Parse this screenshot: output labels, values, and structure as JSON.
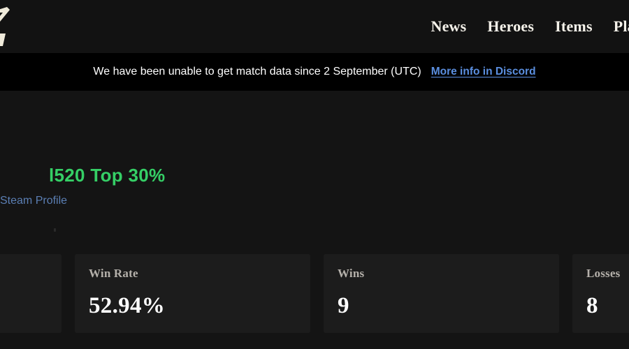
{
  "theme": {
    "page_bg": "#141414",
    "header_bg": "#121212",
    "banner_bg": "#000000",
    "card_bg": "#1c1c1c",
    "accent_green": "#35cf66",
    "link_blue": "#5b8fe0",
    "steam_blue": "#5b7fb4",
    "logo_cream": "#efeada"
  },
  "header": {
    "logo_icon": "site-logo-icon",
    "nav": [
      {
        "label": "News"
      },
      {
        "label": "Heroes"
      },
      {
        "label": "Items"
      },
      {
        "label": "Player"
      }
    ]
  },
  "banner": {
    "message": "We have been unable to get match data since 2 September (UTC)",
    "link_label": "More info in Discord"
  },
  "profile": {
    "rank_text": "l520 Top 30%",
    "steam_link_label": "Steam Profile"
  },
  "stats": {
    "cards": [
      {
        "label": "",
        "value": ""
      },
      {
        "label": "Win Rate",
        "value": "52.94%"
      },
      {
        "label": "Wins",
        "value": "9"
      },
      {
        "label": "Losses",
        "value": "8"
      }
    ]
  }
}
